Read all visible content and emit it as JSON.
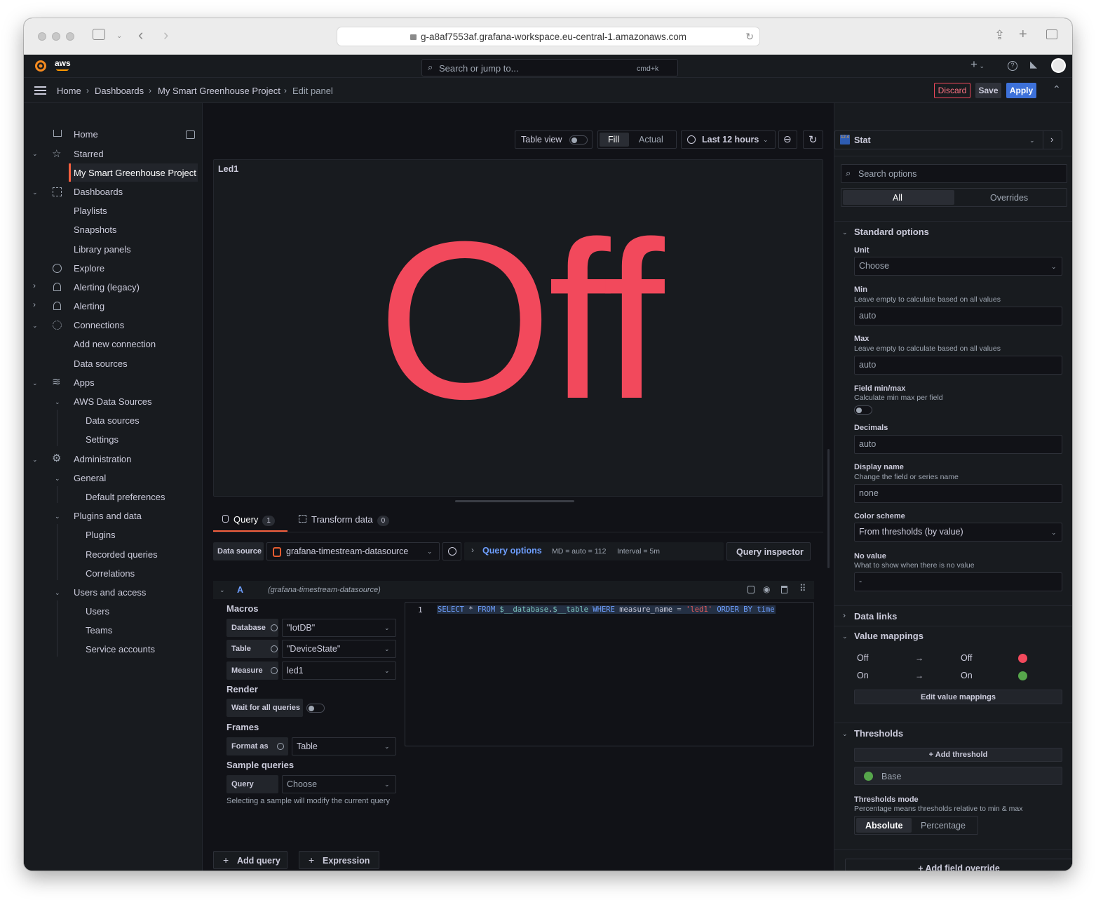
{
  "browser": {
    "url": "g-a8af7553af.grafana-workspace.eu-central-1.amazonaws.com"
  },
  "topbar": {
    "aws_label": "aws",
    "search_placeholder": "Search or jump to...",
    "search_shortcut": "cmd+k",
    "plus_label": "+"
  },
  "breadcrumb": {
    "items": [
      "Home",
      "Dashboards",
      "My Smart Greenhouse Project",
      "Edit panel"
    ],
    "discard": "Discard",
    "save": "Save",
    "apply": "Apply"
  },
  "sidebar": {
    "items": [
      {
        "label": "Home"
      },
      {
        "label": "Starred"
      },
      {
        "label": "My Smart Greenhouse Project"
      },
      {
        "label": "Dashboards"
      },
      {
        "label": "Playlists"
      },
      {
        "label": "Snapshots"
      },
      {
        "label": "Library panels"
      },
      {
        "label": "Explore"
      },
      {
        "label": "Alerting (legacy)"
      },
      {
        "label": "Alerting"
      },
      {
        "label": "Connections"
      },
      {
        "label": "Add new connection"
      },
      {
        "label": "Data sources"
      },
      {
        "label": "Apps"
      },
      {
        "label": "AWS Data Sources"
      },
      {
        "label": "Data sources"
      },
      {
        "label": "Settings"
      },
      {
        "label": "Administration"
      },
      {
        "label": "General"
      },
      {
        "label": "Default preferences"
      },
      {
        "label": "Plugins and data"
      },
      {
        "label": "Plugins"
      },
      {
        "label": "Recorded queries"
      },
      {
        "label": "Correlations"
      },
      {
        "label": "Users and access"
      },
      {
        "label": "Users"
      },
      {
        "label": "Teams"
      },
      {
        "label": "Service accounts"
      }
    ]
  },
  "toolbar": {
    "table_view": "Table view",
    "fill": "Fill",
    "actual": "Actual",
    "time_range": "Last 12 hours"
  },
  "panel": {
    "title": "Led1",
    "value": "Off",
    "value_color": "#f2495c"
  },
  "query_tabs": {
    "query_label": "Query",
    "query_count": "1",
    "transform_label": "Transform data",
    "transform_count": "0"
  },
  "query_bar": {
    "datasource_label": "Data source",
    "datasource_value": "grafana-timestream-datasource",
    "query_options": "Query options",
    "md": "MD = auto = 112",
    "interval": "Interval = 5m",
    "inspector": "Query inspector"
  },
  "query": {
    "ref": "A",
    "datasource": "(grafana-timestream-datasource)",
    "macros_title": "Macros",
    "database_label": "Database",
    "database_value": "\"IotDB\"",
    "table_label": "Table",
    "table_value": "\"DeviceState\"",
    "measure_label": "Measure",
    "measure_value": "led1",
    "render_title": "Render",
    "wait_label": "Wait for all queries",
    "frames_title": "Frames",
    "format_label": "Format as",
    "format_value": "Table",
    "sample_title": "Sample queries",
    "sample_label": "Query",
    "sample_value": "Choose",
    "sample_note": "Selecting a sample will modify the current query",
    "line_number": "1",
    "sql": {
      "select": "SELECT",
      "star": " * ",
      "from": "FROM",
      "db": " $__database",
      "dot": ".",
      "tbl": "$__table ",
      "where": "WHERE",
      "col": " measure_name ",
      "eq": "=",
      "str": " 'led1' ",
      "order": "ORDER BY",
      "time": " time"
    }
  },
  "bottom_buttons": {
    "add_query": "Add query",
    "expression": "Expression"
  },
  "options": {
    "viz_name": "Stat",
    "viz_icon_text": "12.4",
    "search_placeholder": "Search options",
    "tab_all": "All",
    "tab_overrides": "Overrides",
    "standard_title": "Standard options",
    "unit_label": "Unit",
    "unit_value": "Choose",
    "min_label": "Min",
    "min_desc": "Leave empty to calculate based on all values",
    "min_value": "auto",
    "max_label": "Max",
    "max_desc": "Leave empty to calculate based on all values",
    "max_value": "auto",
    "fminmax_label": "Field min/max",
    "fminmax_desc": "Calculate min max per field",
    "decimals_label": "Decimals",
    "decimals_value": "auto",
    "display_label": "Display name",
    "display_desc": "Change the field or series name",
    "display_value": "none",
    "color_label": "Color scheme",
    "color_value": "From thresholds (by value)",
    "novalue_label": "No value",
    "novalue_desc": "What to show when there is no value",
    "novalue_value": "-",
    "data_links": "Data links",
    "value_mappings": "Value mappings",
    "mappings": [
      {
        "from": "Off",
        "arrow": "→",
        "to": "Off",
        "color": "#f2495c"
      },
      {
        "from": "On",
        "arrow": "→",
        "to": "On",
        "color": "#56a64b"
      }
    ],
    "edit_mappings": "Edit value mappings",
    "thresholds": "Thresholds",
    "add_threshold": "Add threshold",
    "base": "Base",
    "base_color": "#56a64b",
    "tmode_label": "Thresholds mode",
    "tmode_desc": "Percentage means thresholds relative to min & max",
    "absolute": "Absolute",
    "percentage": "Percentage",
    "add_override": "Add field override"
  }
}
